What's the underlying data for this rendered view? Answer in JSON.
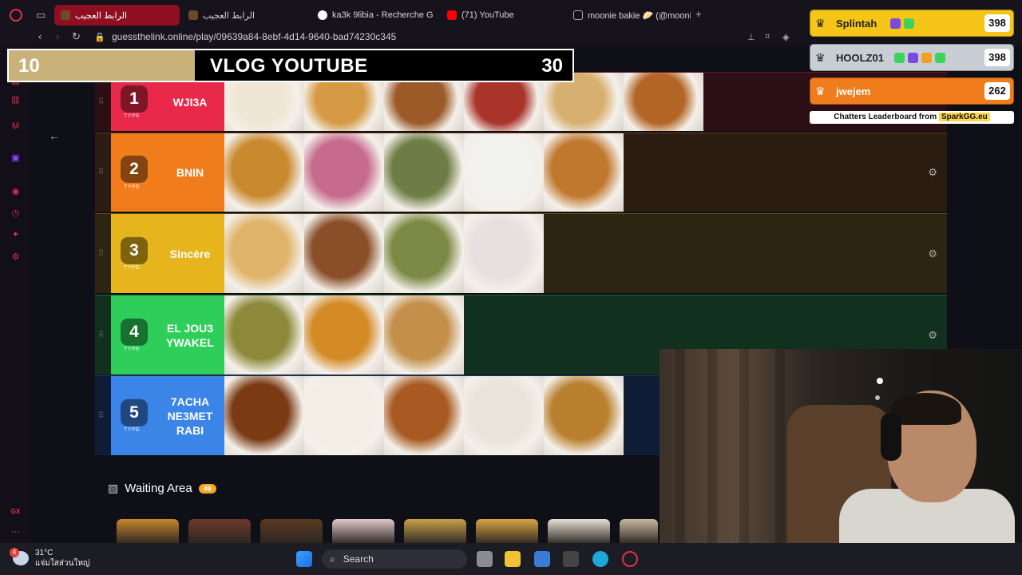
{
  "browser": {
    "tabs": [
      {
        "label": "الرابط العجيب",
        "active": true
      },
      {
        "label": "الرابط العجيب",
        "active": false
      },
      {
        "label": "ka3k 9libia - Recherche G",
        "active": false
      },
      {
        "label": "(71) YouTube",
        "active": false
      },
      {
        "label": "moonie bakie 🥟 (@moonie",
        "active": false
      }
    ],
    "new_tab": "+",
    "url": "guessthelink.online/play/09639a84-8ebf-4d14-9640-bad74230c345"
  },
  "header": {
    "current": "10",
    "title": "VLOG YOUTUBE",
    "total": "30",
    "progress_fraction": 0.33
  },
  "tiers": [
    {
      "rank": "1",
      "type": "TYPE",
      "name": "WJI3A",
      "color": "#e8294a",
      "row_bg": "#2b0f14",
      "items": 6
    },
    {
      "rank": "2",
      "type": "TYPE",
      "name": "BNIN",
      "color": "#f07c1c",
      "row_bg": "#2b1c12",
      "items": 5
    },
    {
      "rank": "3",
      "type": "TYPE",
      "name": "Sincère",
      "color": "#e6b41c",
      "row_bg": "#2b2512",
      "items": 4
    },
    {
      "rank": "4",
      "type": "TYPE",
      "name": "EL JOU3 YWAKEL",
      "color": "#2fce5a",
      "row_bg": "#12301e",
      "items": 3
    },
    {
      "rank": "5",
      "type": "TYPE",
      "name": "7ACHA NE3MET RABI",
      "color": "#3b84e8",
      "row_bg": "#0f1c36",
      "items": 5
    }
  ],
  "waiting": {
    "title": "Waiting Area",
    "count": "49"
  },
  "leaderboard": {
    "rows": [
      {
        "name": "Splintah",
        "score": "398",
        "color": "#f5c518"
      },
      {
        "name": "HOOLZ01",
        "score": "398",
        "color": "#c9ced6"
      },
      {
        "name": "jwejem",
        "score": "262",
        "color": "#f07c1c"
      }
    ],
    "credit_prefix": "Chatters Leaderboard from",
    "credit_brand": "SparkGG.eu"
  },
  "taskbar": {
    "temp": "31°C",
    "location": "แจ่มใสส่วนใหญ่",
    "notif": "4",
    "search_label": "Search"
  }
}
